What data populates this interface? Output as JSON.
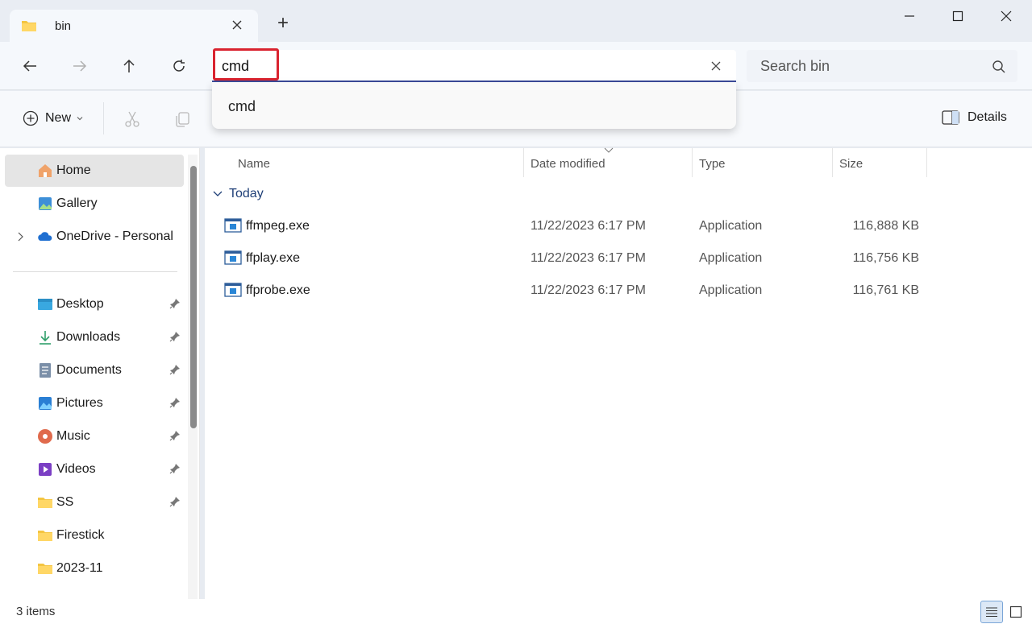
{
  "window": {
    "tab_title": "bin",
    "new_tab_symbol": "+"
  },
  "address_bar": {
    "value": "cmd",
    "suggestion": "cmd"
  },
  "search": {
    "placeholder": "Search bin"
  },
  "commandbar": {
    "new_label": "New",
    "details_label": "Details"
  },
  "sidebar": {
    "items": [
      {
        "label": "Home",
        "icon": "home-icon",
        "active": true
      },
      {
        "label": "Gallery",
        "icon": "gallery-icon"
      },
      {
        "label": "OneDrive - Personal",
        "icon": "onedrive-icon"
      },
      {
        "label": "Desktop",
        "icon": "desktop-icon",
        "pinned": true
      },
      {
        "label": "Downloads",
        "icon": "downloads-icon",
        "pinned": true
      },
      {
        "label": "Documents",
        "icon": "documents-icon",
        "pinned": true
      },
      {
        "label": "Pictures",
        "icon": "pictures-icon",
        "pinned": true
      },
      {
        "label": "Music",
        "icon": "music-icon",
        "pinned": true
      },
      {
        "label": "Videos",
        "icon": "videos-icon",
        "pinned": true
      },
      {
        "label": "SS",
        "icon": "folder-icon",
        "pinned": true
      },
      {
        "label": "Firestick",
        "icon": "folder-icon"
      },
      {
        "label": "2023-11",
        "icon": "folder-icon"
      }
    ]
  },
  "file_list": {
    "columns": [
      "Name",
      "Date modified",
      "Type",
      "Size"
    ],
    "group": "Today",
    "rows": [
      {
        "name": "ffmpeg.exe",
        "date": "11/22/2023 6:17 PM",
        "type": "Application",
        "size": "116,888 KB"
      },
      {
        "name": "ffplay.exe",
        "date": "11/22/2023 6:17 PM",
        "type": "Application",
        "size": "116,756 KB"
      },
      {
        "name": "ffprobe.exe",
        "date": "11/22/2023 6:17 PM",
        "type": "Application",
        "size": "116,761 KB"
      }
    ]
  },
  "status": {
    "item_count": "3 items"
  },
  "colors": {
    "accent": "#3b4b9a",
    "highlight_box": "#d9232f",
    "group_header": "#1f3f77"
  }
}
